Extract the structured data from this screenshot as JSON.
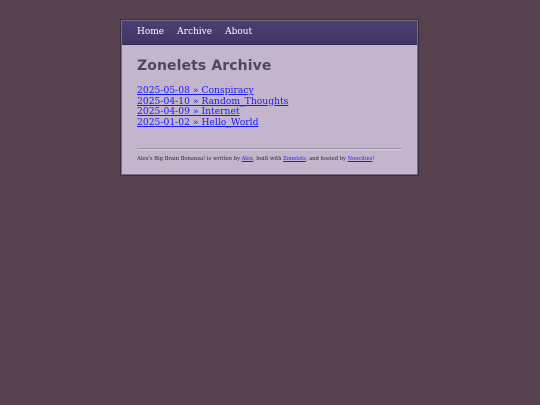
{
  "nav": {
    "items": [
      {
        "label": "Home"
      },
      {
        "label": "Archive"
      },
      {
        "label": "About"
      }
    ]
  },
  "page": {
    "title": "Zonelets Archive"
  },
  "posts": [
    {
      "date": "2025-05-08",
      "sep": " » ",
      "title": "Conspiracy"
    },
    {
      "date": "2025-04-10",
      "sep": " » ",
      "title": "Random_Thoughts"
    },
    {
      "date": "2025-04-09",
      "sep": " » ",
      "title": "Internet"
    },
    {
      "date": "2025-01-02",
      "sep": " » ",
      "title": "Hello_World"
    }
  ],
  "footer": {
    "text1": "Alex's Big Brain Bonanza! is written by ",
    "author": "Alex",
    "text2": ", built with ",
    "builder": "Zonelets",
    "text3": ", and hosted by ",
    "host": "Neocities",
    "text4": "!"
  },
  "colors": {
    "background": "#56414f",
    "panel": "#c3b5cc",
    "nav": "#453b6c",
    "link": "#1a1aff"
  }
}
